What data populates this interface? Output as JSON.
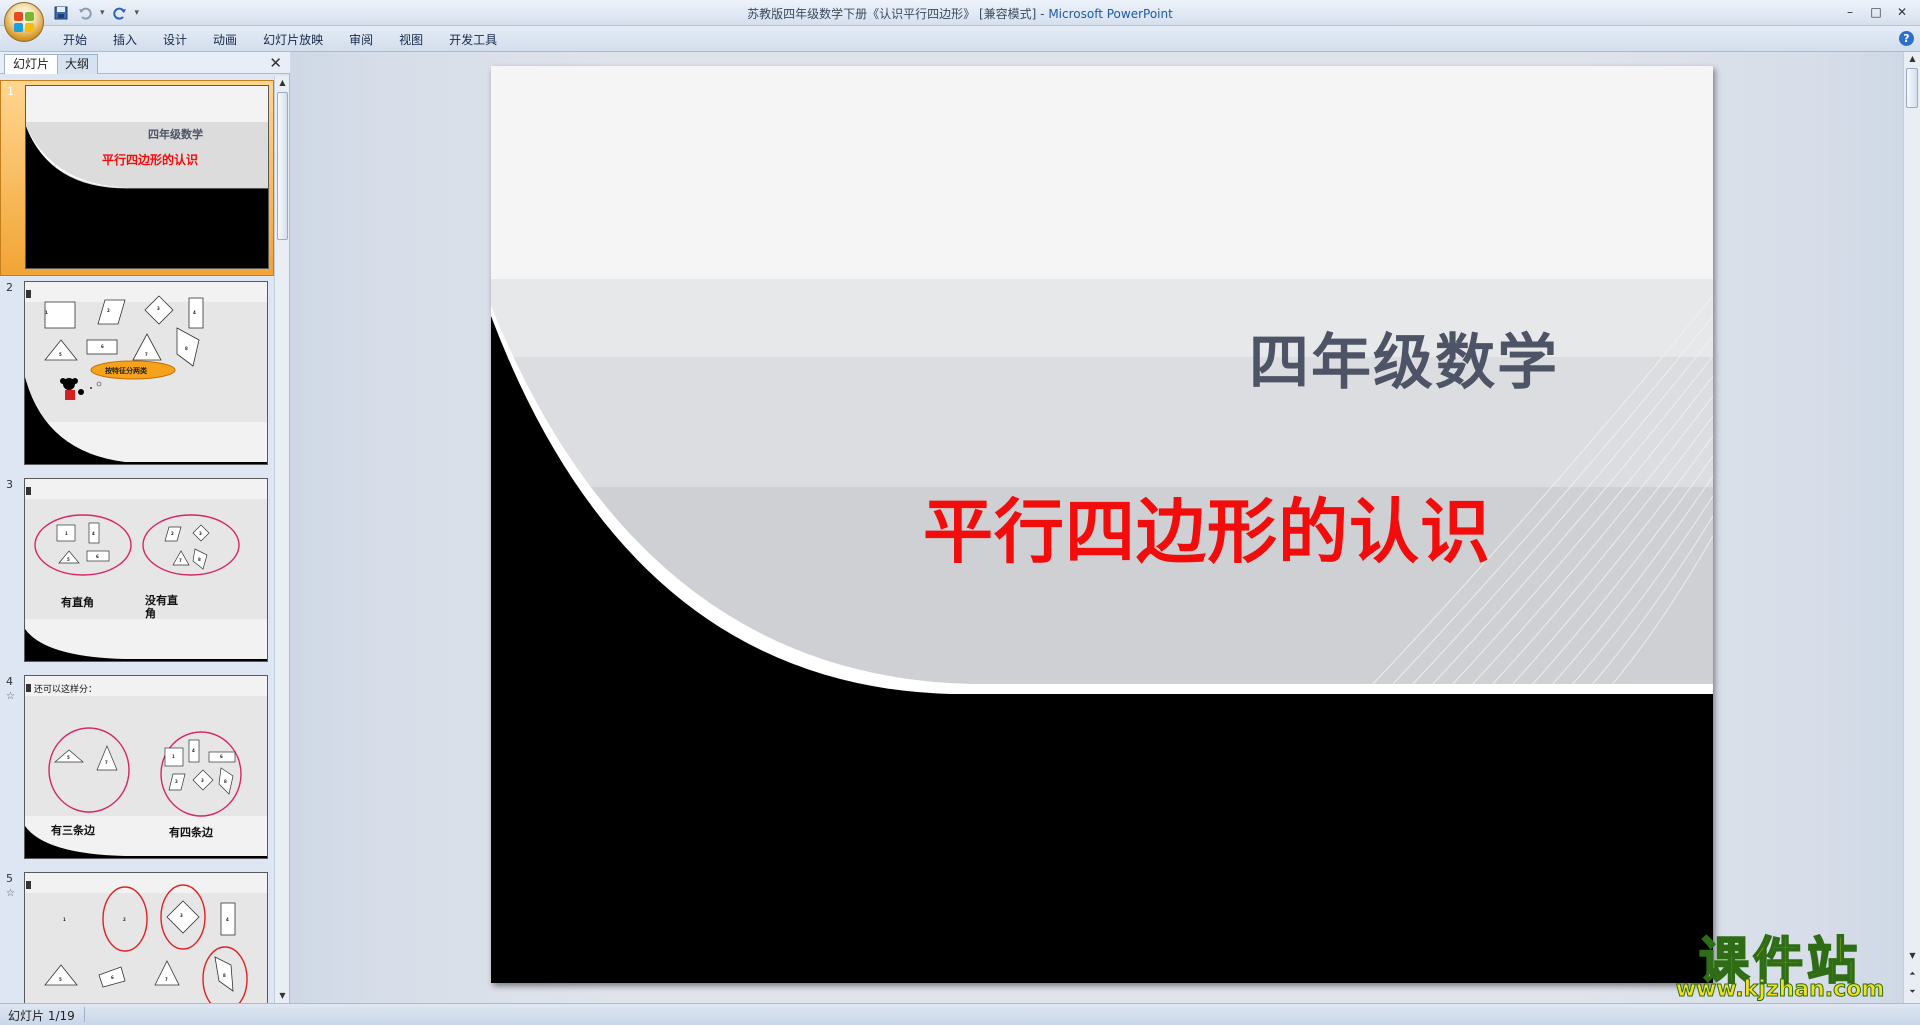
{
  "window": {
    "title": "苏教版四年级数学下册《认识平行四边形》 [兼容模式] - ",
    "app_name": "Microsoft PowerPoint",
    "controls": [
      "–",
      "□",
      "✕"
    ]
  },
  "qat": {
    "dropdown": "▾"
  },
  "ribbon": {
    "tabs": [
      "开始",
      "插入",
      "设计",
      "动画",
      "幻灯片放映",
      "审阅",
      "视图",
      "开发工具"
    ],
    "help": "?"
  },
  "pane": {
    "tabs": {
      "slides": "幻灯片",
      "outline": "大纲"
    },
    "close": "✕"
  },
  "thumbnails": [
    {
      "num": "1",
      "title": "四年级数学",
      "subtitle": "平行四边形的认识"
    },
    {
      "num": "2",
      "cloud": "按特征分两类",
      "shape_labels": [
        "1",
        "2",
        "3",
        "4",
        "5",
        "6",
        "7",
        "8"
      ]
    },
    {
      "num": "3",
      "label_a": "有直角",
      "label_b": "没有直",
      "label_b2": "角",
      "shape_labels": [
        "1",
        "4",
        "6",
        "5",
        "2",
        "3",
        "7",
        "8"
      ]
    },
    {
      "num": "4",
      "star": "☆",
      "heading": "还可以这样分：",
      "label_a": "有三条边",
      "label_b": "有四条边",
      "shape_labels": [
        "5",
        "7",
        "1",
        "4",
        "6",
        "2",
        "3",
        "8"
      ]
    },
    {
      "num": "5",
      "star": "☆",
      "shape_labels": [
        "1",
        "2",
        "3",
        "4",
        "5",
        "6",
        "7",
        "8"
      ]
    }
  ],
  "slide": {
    "title": "四年级数学",
    "subtitle": "平行四边形的认识"
  },
  "status": {
    "slide_counter": "幻灯片 1/19"
  },
  "watermark": {
    "cn": "课件站",
    "url": "www.kjzhan.com"
  },
  "colors": {
    "accent_red": "#f20d0d",
    "title_gray": "#4d5466",
    "selection": "#f2a435"
  }
}
